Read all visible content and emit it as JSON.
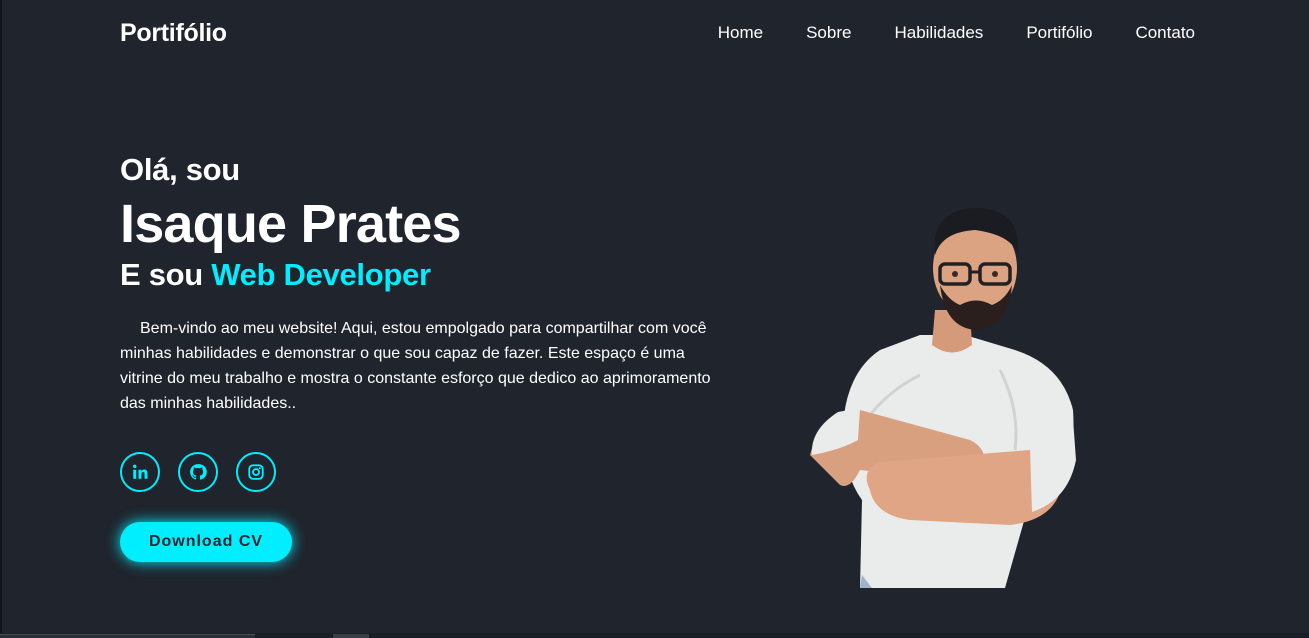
{
  "header": {
    "logo": "Portifólio",
    "nav": [
      "Home",
      "Sobre",
      "Habilidades",
      "Portifólio",
      "Contato"
    ]
  },
  "hero": {
    "greeting": "Olá, sou",
    "name": "Isaque Prates",
    "role_prefix": "E sou",
    "role_accent": "Web Developer",
    "intro": "Bem-vindo ao meu website! Aqui, estou empolgado para compartilhar com você minhas habilidades e demonstrar o que sou capaz de fazer. Este espaço é uma vitrine do meu trabalho e mostra o constante esforço que dedico ao aprimoramento das minhas habilidades..",
    "social_icons": [
      "linkedin-icon",
      "github-icon",
      "instagram-icon"
    ],
    "button": "Download CV"
  },
  "colors": {
    "background": "#1f242d",
    "accent": "#00eeff",
    "text": "#ffffff"
  }
}
